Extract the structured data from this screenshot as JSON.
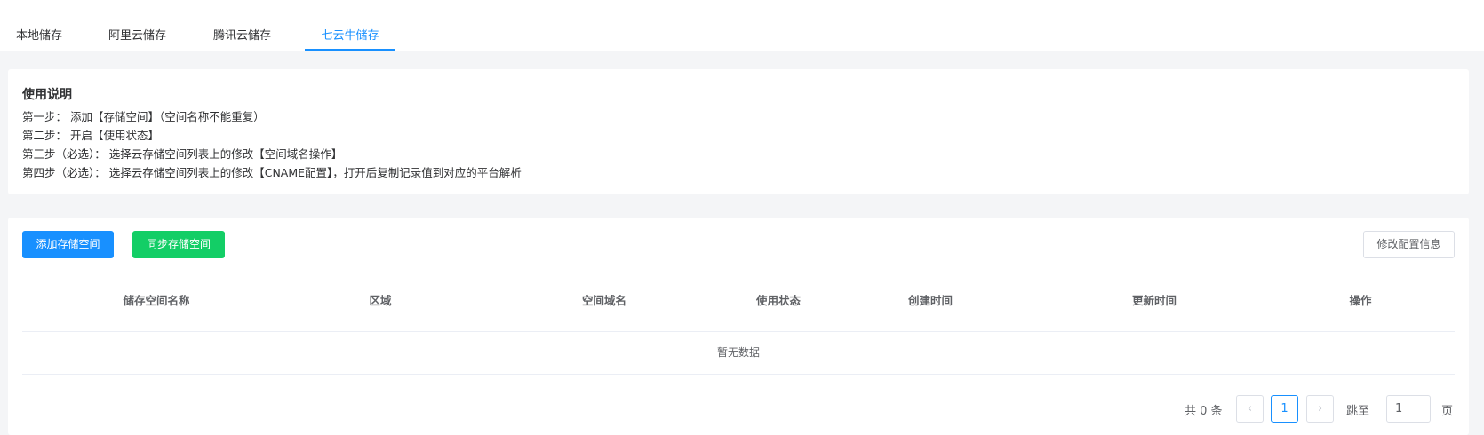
{
  "tabs": [
    {
      "label": "本地储存"
    },
    {
      "label": "阿里云储存"
    },
    {
      "label": "腾讯云储存"
    },
    {
      "label": "七云牛储存"
    }
  ],
  "active_tab": 3,
  "instructions": {
    "title": "使用说明",
    "lines": [
      "第一步： 添加【存储空间】（空间名称不能重复）",
      "第二步： 开启【使用状态】",
      "第三步（必选）： 选择云存储空间列表上的修改【空间域名操作】",
      "第四步（必选）： 选择云存储空间列表上的修改【CNAME配置】，打开后复制记录值到对应的平台解析"
    ]
  },
  "toolbar": {
    "add_label": "添加存储空间",
    "sync_label": "同步存储空间",
    "config_label": "修改配置信息"
  },
  "colors": {
    "primary": "#1890ff",
    "success": "#13ce66"
  },
  "table": {
    "columns": [
      "储存空间名称",
      "区域",
      "空间域名",
      "使用状态",
      "创建时间",
      "更新时间",
      "操作"
    ],
    "empty_text": "暂无数据"
  },
  "pagination": {
    "total_text": "共 0 条",
    "prev_icon": "‹",
    "next_icon": "›",
    "current_page": "1",
    "jump_label": "跳至",
    "jump_value": "1",
    "page_unit": "页"
  }
}
